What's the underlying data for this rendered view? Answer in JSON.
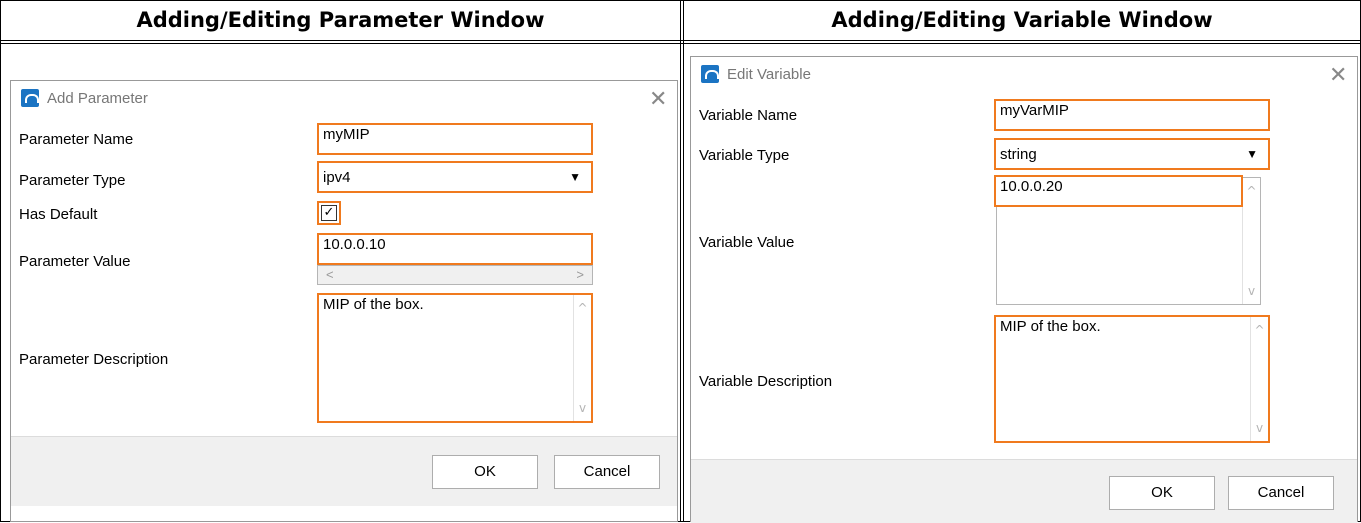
{
  "left": {
    "header": "Adding/Editing Parameter Window",
    "dialog_title": "Add Parameter",
    "close": "✕",
    "fields": {
      "name_label": "Parameter Name",
      "name_value": "myMIP",
      "type_label": "Parameter Type",
      "type_value": "ipv4",
      "default_label": "Has Default",
      "default_checked": "✓",
      "value_label": "Parameter Value",
      "value_value": "10.0.0.10",
      "desc_label": "Parameter Description",
      "desc_value": "MIP of the box."
    },
    "ok": "OK",
    "cancel": "Cancel"
  },
  "right": {
    "header": "Adding/Editing Variable Window",
    "dialog_title": "Edit Variable",
    "close": "✕",
    "fields": {
      "name_label": "Variable Name",
      "name_value": "myVarMIP",
      "type_label": "Variable Type",
      "type_value": "string",
      "value_label": "Variable Value",
      "value_value": "10.0.0.20",
      "desc_label": "Variable Description",
      "desc_value": "MIP of the box."
    },
    "ok": "OK",
    "cancel": "Cancel"
  },
  "icons": {
    "dialog_icon": "app-icon",
    "dropdown": "▼",
    "scroll_left": "<",
    "scroll_right": ">",
    "scroll_up": "^",
    "scroll_down": "v"
  },
  "colors": {
    "highlight": "#f07a1e",
    "footer_bg": "#f0f0f0",
    "icon_blue": "#1b74c3"
  }
}
